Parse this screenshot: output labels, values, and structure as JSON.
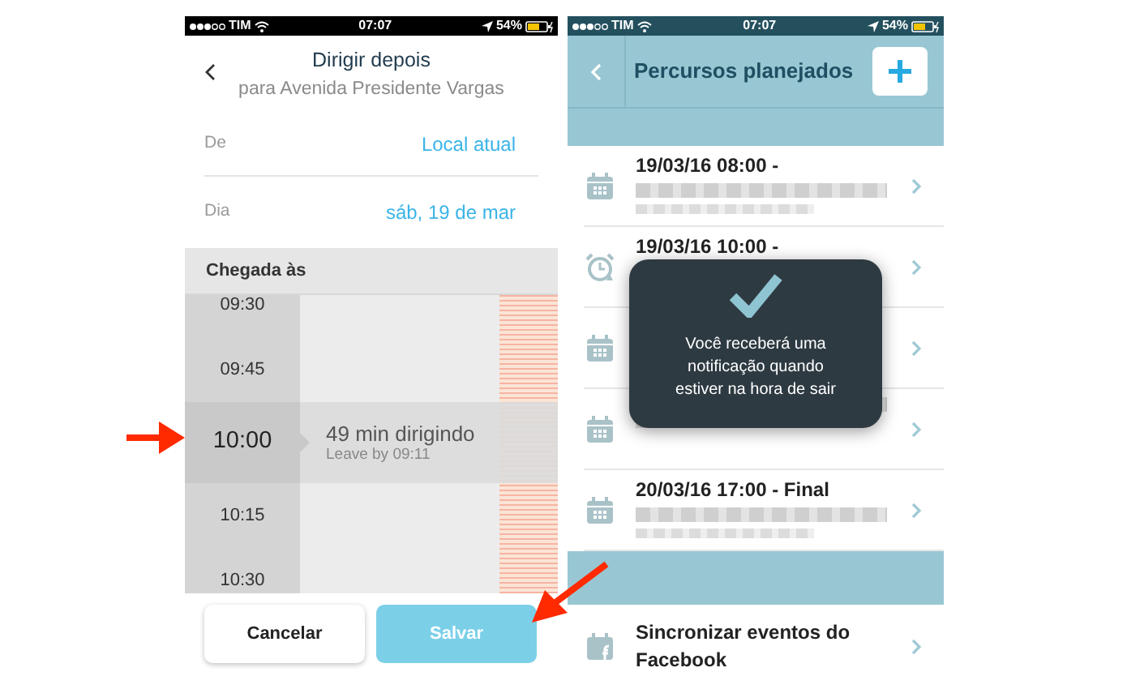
{
  "left_screen": {
    "status_bar": {
      "carrier": "TIM",
      "time": "07:07",
      "battery": "54%"
    },
    "header": {
      "title": "Dirigir depois",
      "subtitle": "para Avenida Presidente Vargas"
    },
    "fields": [
      {
        "label": "De",
        "value": "Local atual"
      },
      {
        "label": "Dia",
        "value": "sáb, 19 de mar"
      }
    ],
    "picker": {
      "heading": "Chegada às",
      "times": [
        {
          "time": "09:30",
          "selected": false
        },
        {
          "time": "09:45",
          "selected": false
        },
        {
          "time": "10:00",
          "selected": true,
          "duration": "49 min dirigindo",
          "leave_by": "Leave by 09:11"
        },
        {
          "time": "10:15",
          "selected": false
        },
        {
          "time": "10:30",
          "selected": false
        }
      ]
    },
    "buttons": [
      {
        "label": "Cancelar",
        "kind": "secondary"
      },
      {
        "label": "Salvar",
        "kind": "primary"
      }
    ]
  },
  "right_screen": {
    "status_bar": {
      "carrier": "TIM",
      "time": "07:07",
      "battery": "54%"
    },
    "header": {
      "title": "Percursos planejados"
    },
    "trips": [
      {
        "kind": "calendar",
        "title": "19/03/16 08:00 -",
        "blurred": true
      },
      {
        "kind": "alarm",
        "title": "19/03/16 10:00 -",
        "blurred": false
      },
      {
        "kind": "calendar",
        "blurred": false
      },
      {
        "kind": "calendar",
        "blurred": true
      },
      {
        "kind": "calendar",
        "title": "20/03/16 17:00 - Final",
        "blurred": true
      }
    ],
    "sync_item": {
      "label": "Sincronizar eventos do Facebook"
    },
    "toast": {
      "message": "Você receberá uma notificação quando estiver na hora de sair"
    }
  }
}
